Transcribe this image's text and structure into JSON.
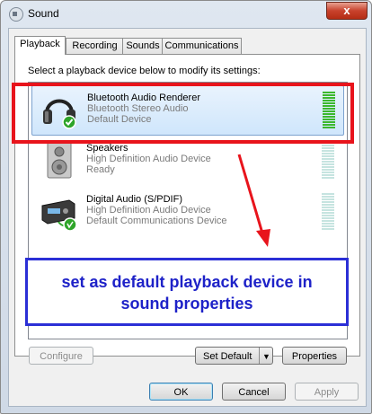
{
  "window": {
    "title": "Sound",
    "close_glyph": "x"
  },
  "tabs": [
    {
      "label": "Playback",
      "active": true
    },
    {
      "label": "Recording",
      "active": false
    },
    {
      "label": "Sounds",
      "active": false
    },
    {
      "label": "Communications",
      "active": false
    }
  ],
  "instruction": "Select a playback device below to modify its settings:",
  "devices": [
    {
      "name": "Bluetooth Audio Renderer",
      "description": "Bluetooth Stereo Audio",
      "status": "Default Device",
      "icon": "headphones-icon",
      "selected": true,
      "level": 1.0
    },
    {
      "name": "Speakers",
      "description": "High Definition Audio Device",
      "status": "Ready",
      "icon": "speaker-icon",
      "selected": false,
      "level": 0
    },
    {
      "name": "Digital Audio (S/PDIF)",
      "description": "High Definition Audio Device",
      "status": "Default Communications Device",
      "icon": "digital-audio-icon",
      "selected": false,
      "level": 0
    }
  ],
  "callout": {
    "line1": "set as default playback device in",
    "line2": "sound properties"
  },
  "buttons": {
    "configure": "Configure",
    "set_default": "Set Default",
    "properties": "Properties",
    "ok": "OK",
    "cancel": "Cancel",
    "apply": "Apply"
  },
  "colors": {
    "highlight_red": "#e8141c",
    "callout_blue": "#2b2fd6",
    "meter_green": "#3cb82e",
    "check_green": "#2fa52a"
  }
}
